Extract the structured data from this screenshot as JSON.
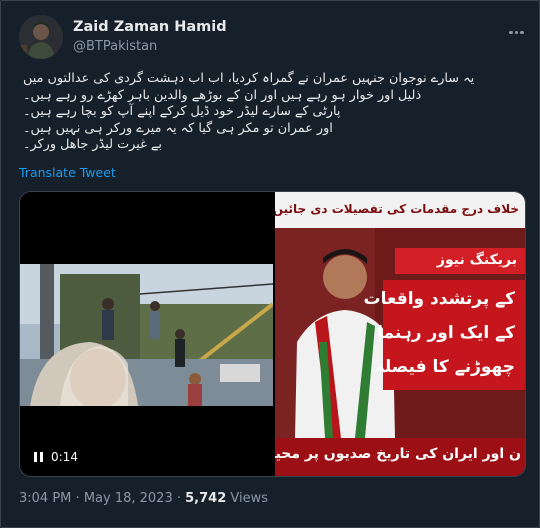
{
  "author": {
    "display_name": "Zaid Zaman Hamid",
    "handle": "@BTPakistan"
  },
  "tweet": {
    "lines": [
      "یہ سارے نوجوان جنہیں عمران نے گمراہ کردیا، اب اب دہشت گردی کی عدالتوں میں",
      "ذلیل اور خوار ہو رہے ہیں اور ان کے بوڑھے والدین باہر کھڑے رو رہے ہیں۔",
      "پارٹی کے سارے لیڈر خود ڈیل کرکے اپنے آپ کو بچا رہے ہیں۔",
      "اور عمران تو مکر ہی گیا کہ یہ میرے ورکر ہی نہیں ہیں۔",
      "بے غیرت لیڈر جاھل ورکر۔"
    ],
    "translate_label": "Translate Tweet"
  },
  "media": {
    "video_time": "0:14",
    "news_top": "خلاف درج مقدمات کی تفصیلات دی جائیں، درخو",
    "news_tag": "بریکنگ نیوز",
    "news_lines": [
      "کے پرتشدد واقعات",
      "کے ایک اور رہنما",
      "چھوڑنے کا فیصلہ"
    ],
    "news_bottom": "ن اور ایران کی تاریخ صدیوں پر محیط ہے، وزیرا"
  },
  "meta": {
    "time": "3:04 PM",
    "date": "May 18, 2023",
    "separator": "·",
    "views_count": "5,742",
    "views_label": "Views"
  },
  "colors": {
    "background": "#15202b",
    "link": "#1d9bf0",
    "muted": "#8b98a5",
    "news_red": "#c4161c"
  }
}
